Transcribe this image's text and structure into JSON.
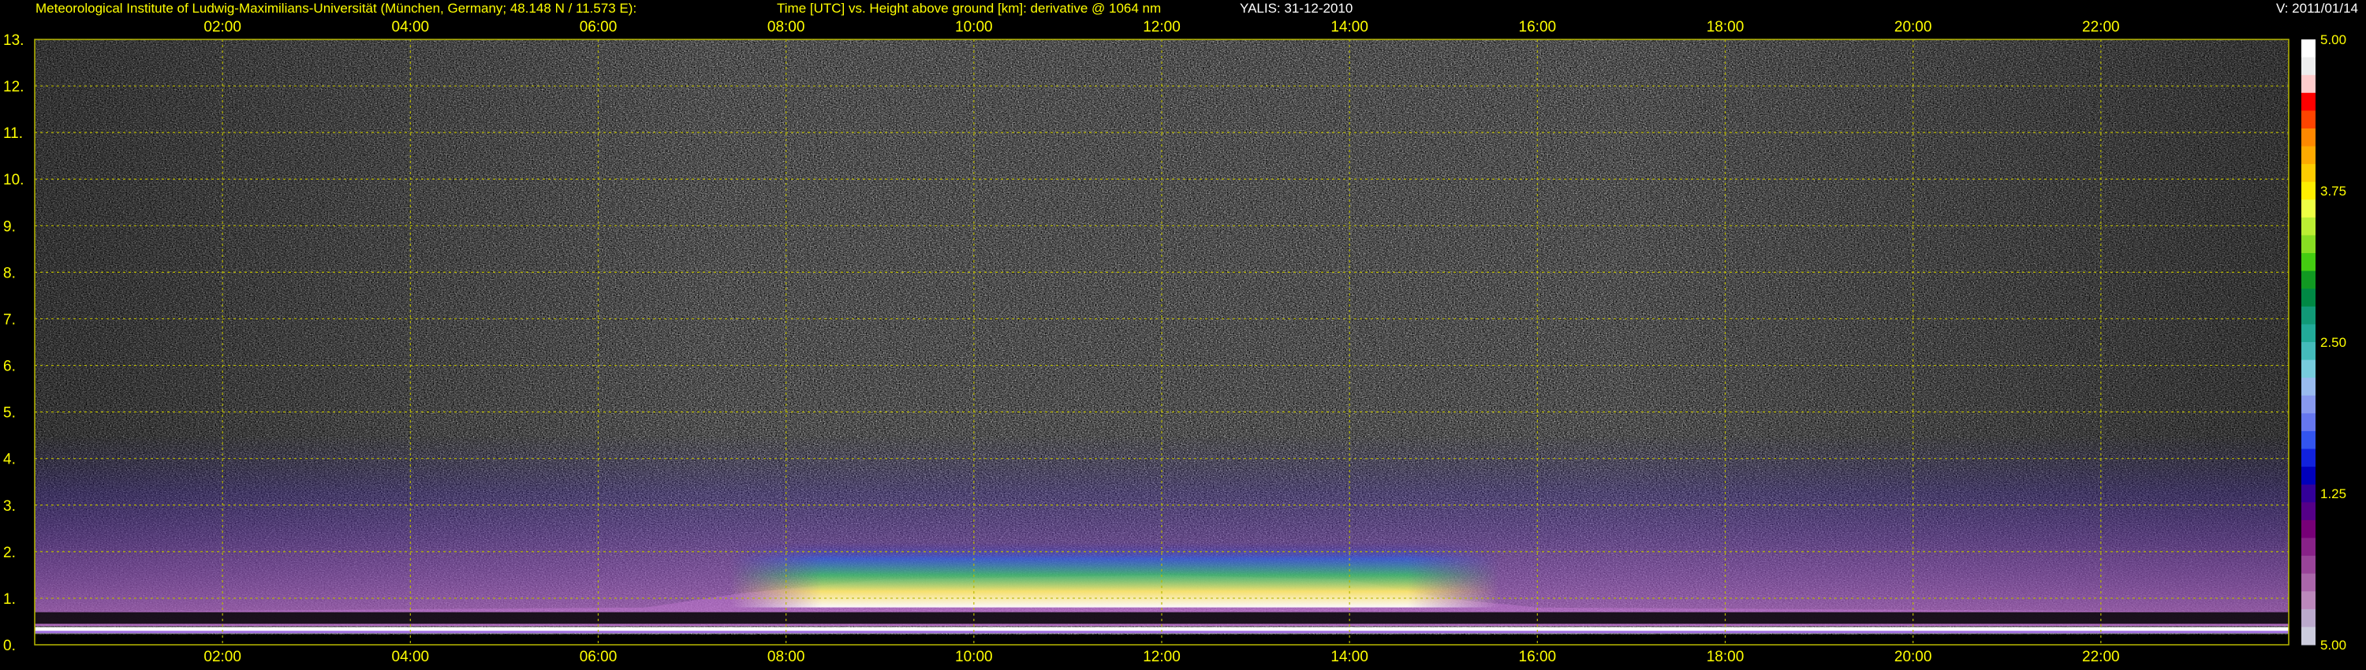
{
  "header": {
    "institute": "Meteorological Institute of Ludwig-Maximilians-Universität (München, Germany; 48.148 N / 11.573 E):",
    "axes_description": "Time [UTC] vs. Height above ground [km]: derivative @ 1064 nm",
    "instrument_date": "YALIS: 31-12-2010",
    "version": "V: 2011/01/14"
  },
  "colors": {
    "text": "#ffff00",
    "grid": "#b8b800",
    "background": "#000000"
  },
  "chart_data": {
    "type": "heatmap",
    "title": "Time [UTC] vs. Height above ground [km]: derivative @ 1064 nm",
    "xlabel": "Time [UTC]",
    "ylabel": "Height above ground [km]",
    "xlim": [
      0,
      24
    ],
    "ylim": [
      0,
      13
    ],
    "grid": true,
    "x_ticks": [
      "02:00",
      "04:00",
      "06:00",
      "08:00",
      "10:00",
      "12:00",
      "14:00",
      "16:00",
      "18:00",
      "20:00",
      "22:00"
    ],
    "x_tick_hours": [
      2,
      4,
      6,
      8,
      10,
      12,
      14,
      16,
      18,
      20,
      22
    ],
    "y_ticks": [
      "0.",
      "1.",
      "2.",
      "3.",
      "4.",
      "5.",
      "6.",
      "7.",
      "8.",
      "9.",
      "10.",
      "11.",
      "12.",
      "13."
    ],
    "y_tick_values": [
      0,
      1,
      2,
      3,
      4,
      5,
      6,
      7,
      8,
      9,
      10,
      11,
      12,
      13
    ],
    "colorbar": {
      "labels": [
        "5.00",
        "3.75",
        "2.50",
        "1.25",
        "5.00"
      ],
      "positions": [
        0,
        0.25,
        0.5,
        0.75,
        1.0
      ],
      "colors_top_to_bottom": [
        "#ffffff",
        "#eeeeee",
        "#ffcccc",
        "#ff0000",
        "#ff4400",
        "#ff8800",
        "#ffaa00",
        "#ffcc00",
        "#ffee00",
        "#eeff44",
        "#bbee33",
        "#88dd22",
        "#44cc11",
        "#119922",
        "#008844",
        "#119977",
        "#22aa99",
        "#44bbbb",
        "#77ccdd",
        "#99bbee",
        "#8899ee",
        "#6677ee",
        "#3355ee",
        "#1122dd",
        "#0000bb",
        "#330099",
        "#550088",
        "#770077",
        "#882288",
        "#994499",
        "#aa66aa",
        "#bb88bb",
        "#bbaacc",
        "#ccccdd"
      ]
    },
    "features": {
      "boundary_layer_top_km": [
        [
          0,
          0.7
        ],
        [
          6.5,
          0.8
        ],
        [
          7.5,
          1.1
        ],
        [
          9,
          1.4
        ],
        [
          12,
          1.5
        ],
        [
          14,
          1.4
        ],
        [
          15,
          1.0
        ],
        [
          16,
          0.8
        ],
        [
          24,
          0.7
        ]
      ],
      "aerosol_band_km": [
        0.4,
        3.0
      ],
      "noise_above_km": 4.5
    }
  }
}
